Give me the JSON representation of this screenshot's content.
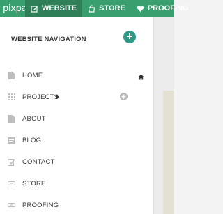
{
  "topbar": {
    "logo_text": "pixpa",
    "tabs": [
      {
        "label": "WEBSITE",
        "icon": "edit-icon",
        "active": true
      },
      {
        "label": "STORE",
        "icon": "shopping-bag-icon",
        "active": false
      },
      {
        "label": "PROOFING",
        "icon": "heart-icon",
        "active": false
      }
    ]
  },
  "sidebar": {
    "header": "WEBSITE NAVIGATION",
    "items": [
      {
        "label": "HOME",
        "icon": "page-icon",
        "is_homepage": true
      },
      {
        "label": "PROJECTS",
        "icon": "grid-dots-icon",
        "has_submenu": true
      },
      {
        "label": "ABOUT",
        "icon": "page-icon"
      },
      {
        "label": "BLOG",
        "icon": "blog-icon"
      },
      {
        "label": "CONTACT",
        "icon": "contact-form-icon"
      },
      {
        "label": "STORE",
        "icon": "store-link-icon"
      },
      {
        "label": "PROOFING",
        "icon": "proofing-link-icon"
      }
    ]
  },
  "colors": {
    "topbar_bg": "#3a9f6f",
    "topbar_active": "#2f7f58",
    "add_button": "#2e9a86",
    "text": "#3a3a3a"
  }
}
